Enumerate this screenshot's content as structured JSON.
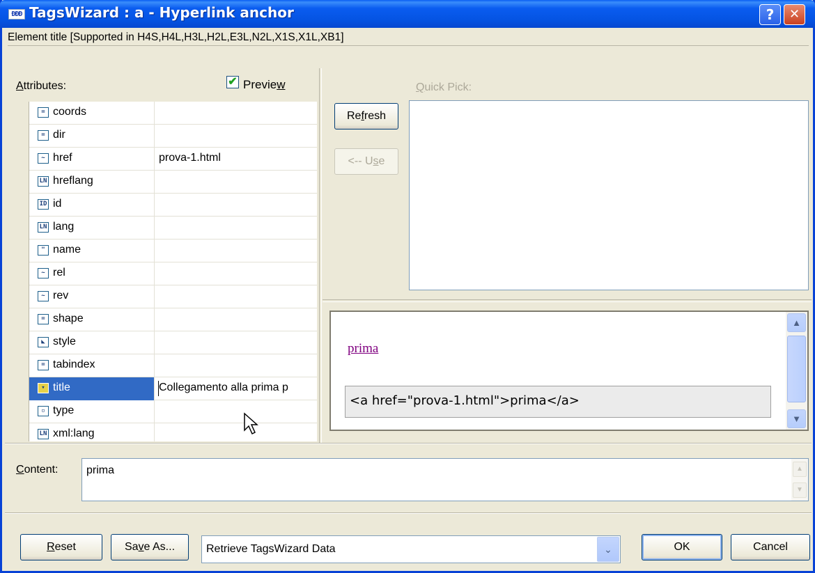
{
  "window": {
    "icon_text": "ĐĐĐ",
    "title": "TagsWizard : a - Hyperlink anchor",
    "help_glyph": "?",
    "close_glyph": "✕"
  },
  "element_title": "Element title  [Supported in H4S,H4L,H3L,H2L,E3L,N2L,X1S,X1L,XB1]",
  "attributes": {
    "label": "Attributes:",
    "preview_label": "Preview",
    "preview_checked": true,
    "rows": [
      {
        "name": "coords",
        "value": "",
        "icon": "=",
        "selected": false
      },
      {
        "name": "dir",
        "value": "",
        "icon": "=",
        "selected": false
      },
      {
        "name": "href",
        "value": "prova-1.html",
        "icon": "~",
        "selected": false
      },
      {
        "name": "hreflang",
        "value": "",
        "icon": "LN",
        "selected": false
      },
      {
        "name": "id",
        "value": "",
        "icon": "ID",
        "selected": false
      },
      {
        "name": "lang",
        "value": "",
        "icon": "LN",
        "selected": false
      },
      {
        "name": "name",
        "value": "",
        "icon": "\"",
        "selected": false
      },
      {
        "name": "rel",
        "value": "",
        "icon": "~",
        "selected": false
      },
      {
        "name": "rev",
        "value": "",
        "icon": "~",
        "selected": false
      },
      {
        "name": "shape",
        "value": "",
        "icon": "=",
        "selected": false
      },
      {
        "name": "style",
        "value": "",
        "icon": "◣",
        "selected": false
      },
      {
        "name": "tabindex",
        "value": "",
        "icon": "=",
        "selected": false
      },
      {
        "name": "title",
        "value": "Collegamento alla prima p",
        "icon": "▾",
        "selected": true
      },
      {
        "name": "type",
        "value": "",
        "icon": "▫",
        "selected": false
      },
      {
        "name": "xml:lang",
        "value": "",
        "icon": "LN",
        "selected": false
      }
    ]
  },
  "quick_pick": {
    "label": "Quick Pick:",
    "refresh_label": "Refresh",
    "use_label": "<-- Use"
  },
  "preview": {
    "link_text": "prima",
    "code": "<a href=\"prova-1.html\">prima</a>"
  },
  "content": {
    "label": "Content:",
    "value": "prima"
  },
  "footer": {
    "reset_label": "Reset",
    "save_as_label": "Save As...",
    "combo_value": "Retrieve TagsWizard Data",
    "ok_label": "OK",
    "cancel_label": "Cancel"
  }
}
